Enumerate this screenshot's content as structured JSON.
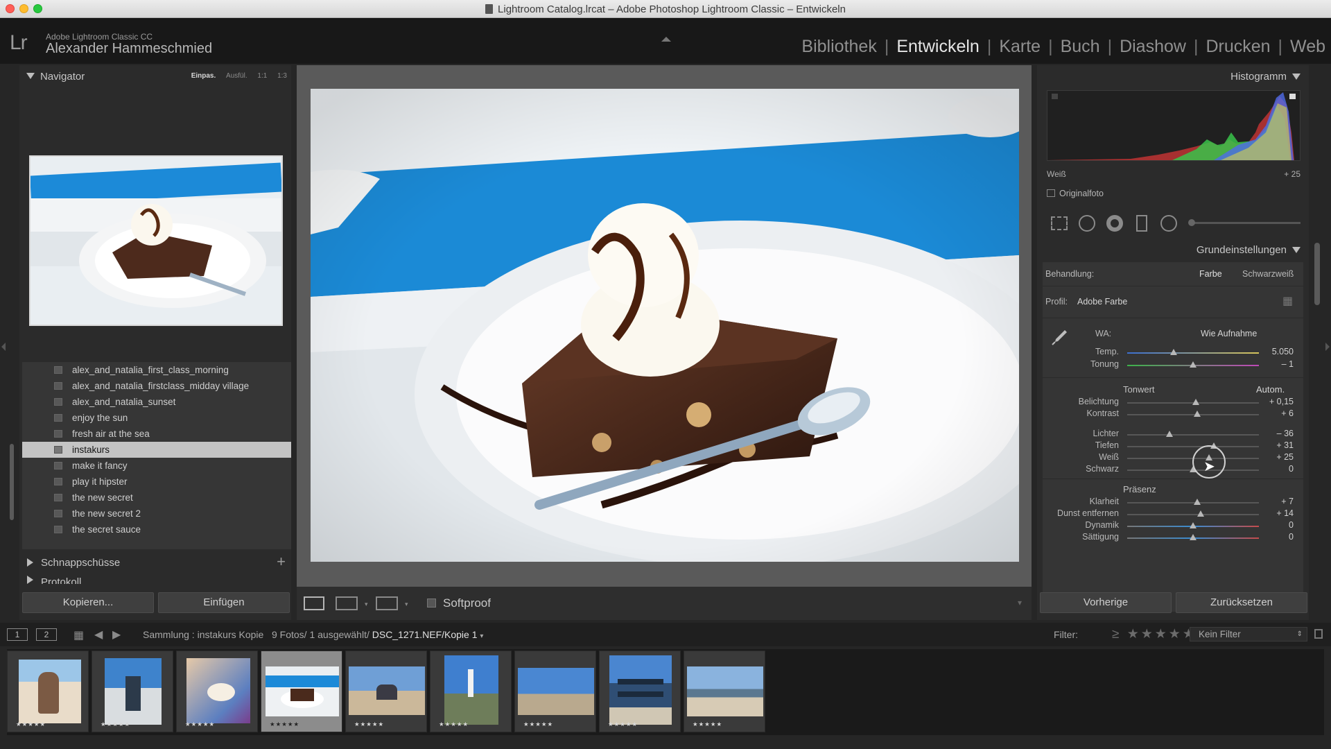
{
  "window": {
    "title": "Lightroom Catalog.lrcat – Adobe Photoshop Lightroom Classic – Entwickeln"
  },
  "identity": {
    "logo": "Lr",
    "product": "Adobe Lightroom Classic CC",
    "user": "Alexander Hammeschmied"
  },
  "modules": [
    "Bibliothek",
    "Entwickeln",
    "Karte",
    "Buch",
    "Diashow",
    "Drucken",
    "Web"
  ],
  "active_module": "Entwickeln",
  "navigator": {
    "title": "Navigator",
    "zoom_options": [
      "Einpas.",
      "Ausfül.",
      "1:1",
      "1:3"
    ],
    "active_zoom": "Einpas."
  },
  "collections": [
    "alex_and_natalia_first_class_morning",
    "alex_and_natalia_firstclass_midday village",
    "alex_and_natalia_sunset",
    "enjoy the sun",
    "fresh air at the sea",
    "instakurs",
    "make it fancy",
    "play it hipster",
    "the new secret",
    "the new secret 2",
    "the secret sauce"
  ],
  "selected_collection": "instakurs",
  "panels_left": {
    "snapshots": "Schnappschüsse",
    "history": "Protokoll",
    "copy_button": "Kopieren...",
    "paste_button": "Einfügen"
  },
  "toolbar": {
    "softproof": "Softproof"
  },
  "histogram": {
    "title": "Histogramm",
    "info_label": "Weiß",
    "info_value": "+ 25",
    "original_photo": "Originalfoto"
  },
  "basic": {
    "title": "Grundeinstellungen",
    "treatment_label": "Behandlung:",
    "treatment_color": "Farbe",
    "treatment_bw": "Schwarzweiß",
    "profile_label": "Profil:",
    "profile_value": "Adobe Farbe",
    "wb_label": "WA:",
    "wb_value": "Wie Aufnahme",
    "tone_title": "Tonwert",
    "auto": "Autom.",
    "presence_title": "Präsenz",
    "sliders": {
      "temp": {
        "label": "Temp.",
        "value": "5.050",
        "pos": 0.35
      },
      "tint": {
        "label": "Tonung",
        "value": "– 1",
        "pos": 0.5
      },
      "exposure": {
        "label": "Belichtung",
        "value": "+ 0,15",
        "pos": 0.52
      },
      "contrast": {
        "label": "Kontrast",
        "value": "+ 6",
        "pos": 0.53
      },
      "highlights": {
        "label": "Lichter",
        "value": "– 36",
        "pos": 0.32
      },
      "shadows": {
        "label": "Tiefen",
        "value": "+ 31",
        "pos": 0.66
      },
      "whites": {
        "label": "Weiß",
        "value": "+ 25",
        "pos": 0.62
      },
      "blacks": {
        "label": "Schwarz",
        "value": "0",
        "pos": 0.5
      },
      "clarity": {
        "label": "Klarheit",
        "value": "+ 7",
        "pos": 0.53
      },
      "dehaze": {
        "label": "Dunst entfernen",
        "value": "+ 14",
        "pos": 0.56
      },
      "vibrance": {
        "label": "Dynamik",
        "value": "0",
        "pos": 0.5
      },
      "saturation": {
        "label": "Sättigung",
        "value": "0",
        "pos": 0.5
      }
    },
    "previous_button": "Vorherige",
    "reset_button": "Zurücksetzen"
  },
  "filmstrip": {
    "monitor_1": "1",
    "monitor_2": "2",
    "source_prefix": "Sammlung : instakurs Kopie",
    "count": "9 Fotos/ 1 ausgewählt/",
    "file": "DSC_1271.NEF/Kopie 1",
    "filter_label": "Filter:",
    "filter_value": "Kein Filter",
    "rating": "★★★★★"
  },
  "colors": {
    "accent": "#1e8fd6",
    "panel": "#2b2b2b",
    "selected_row": "#c4c4c4"
  }
}
